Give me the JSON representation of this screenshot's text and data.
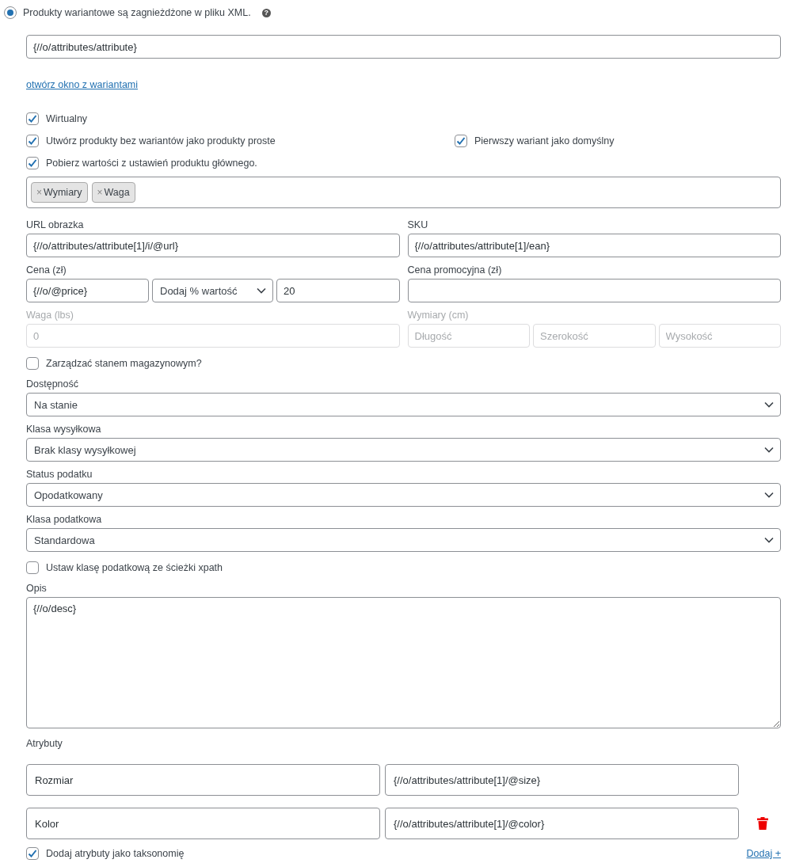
{
  "variant_mode": {
    "label": "Produkty wariantowe są zagnieżdżone w pliku XML.",
    "selected": true,
    "help": "?"
  },
  "xpath_field": {
    "value": "{//o/attributes/attribute}"
  },
  "variants_link": "otwórz okno z wariantami",
  "options": [
    [
      {
        "label": "Wirtualny",
        "checked": true
      }
    ],
    [
      {
        "label": "Utwórz produkty bez wariantów jako produkty proste",
        "checked": true
      },
      {
        "label": "Pierwszy wariant jako domyślny",
        "checked": true
      }
    ],
    [
      {
        "label": "Pobierz wartości z ustawień produktu głównego.",
        "checked": true
      }
    ]
  ],
  "inherit_tags": [
    {
      "remove": "×",
      "label": "Wymiary"
    },
    {
      "remove": "×",
      "label": "Waga"
    }
  ],
  "image_url": {
    "label": "URL obrazka",
    "value": "{//o/attributes/attribute[1]/i/@url}"
  },
  "sku": {
    "label": "SKU",
    "value": "{//o/attributes/attribute[1]/ean}"
  },
  "price": {
    "label": "Cena (zł)",
    "value": "{//o/@price}",
    "modifier": "Dodaj % wartość",
    "amount": "20"
  },
  "sale_price": {
    "label": "Cena promocyjna (zł)"
  },
  "weight": {
    "label": "Waga (lbs)",
    "placeholder": "0",
    "disabled": true
  },
  "dimensions": {
    "label": "Wymiary (cm)",
    "disabled": true,
    "placeholders": [
      "Długość",
      "Szerokość",
      "Wysokość"
    ]
  },
  "manage_stock": {
    "label": "Zarządzać stanem magazynowym?",
    "checked": false
  },
  "selects": [
    {
      "label": "Dostępność",
      "value": "Na stanie"
    },
    {
      "label": "Klasa wysyłkowa",
      "value": "Brak klasy wysyłkowej"
    },
    {
      "label": "Status podatku",
      "value": "Opodatkowany"
    },
    {
      "label": "Klasa podatkowa",
      "value": "Standardowa"
    }
  ],
  "tax_xpath": {
    "label": "Ustaw klasę podatkową ze ścieżki xpath",
    "checked": false
  },
  "description": {
    "label": "Opis",
    "value": "{//o/desc}"
  },
  "attributes": {
    "label": "Atrybuty",
    "rows": [
      {
        "name": "Rozmiar",
        "value": "{//o/attributes/attribute[1]/@size}",
        "deletable": false
      },
      {
        "name": "Kolor",
        "value": "{//o/attributes/attribute[1]/@color}",
        "deletable": true
      }
    ]
  },
  "as_taxonomy": {
    "label": "Dodaj atrybuty jako taksonomię",
    "checked": true
  },
  "add_link": "Dodaj +"
}
